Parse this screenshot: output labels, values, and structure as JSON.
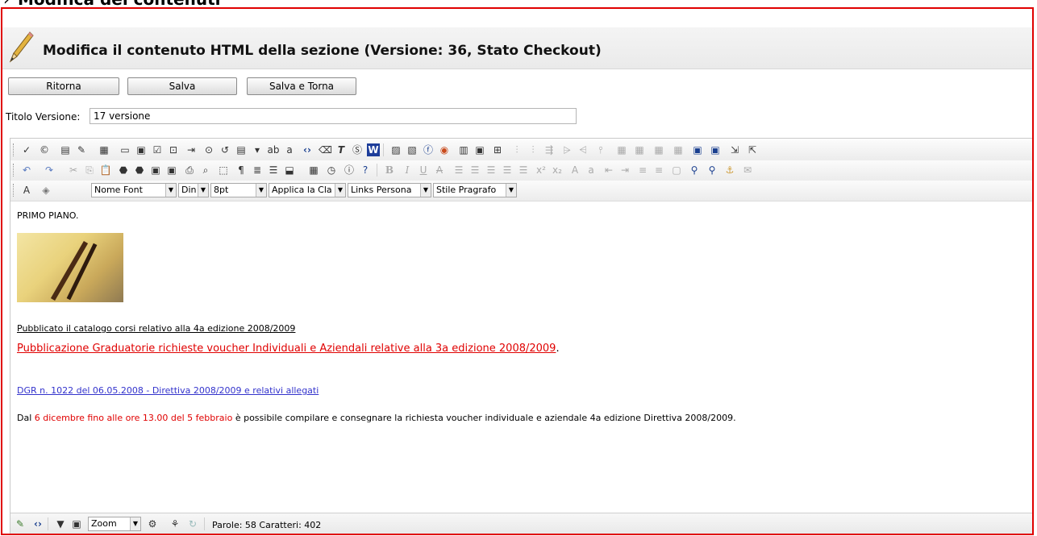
{
  "page": {
    "heading": "Modifica dei contenuti",
    "heading_marker": "›",
    "title": "Modifica il contenuto HTML della sezione (Versione: 36, Stato Checkout)"
  },
  "actions": {
    "back": "Ritorna",
    "save": "Salva",
    "save_return": "Salva e Torna"
  },
  "version": {
    "label": "Titolo Versione:",
    "value": "17 versione"
  },
  "toolbar": {
    "font_name": "Nome Font",
    "font_size_unit": "Din",
    "font_size": "8pt",
    "css_class": "Applica la Cla",
    "links": "Links Persona",
    "paragraph_style": "Stile Pragrafo"
  },
  "content": {
    "line1": "PRIMO PIANO.",
    "link1": "Pubblicato il catalogo corsi relativo alla 4a edizione 2008/2009",
    "link2": "Pubblicazione Graduatorie richieste voucher Individuali e Aziendali relative alla 3a edizione 2008/2009",
    "link2_end": ".",
    "link3": "DGR n. 1022 del 06.05.2008 - Direttiva 2008/2009 e relativi allegati",
    "line_start": "Dal ",
    "line_red": "6 dicembre fino alle ore 13.00 del 5 febbraio",
    "line_end": " è possibile compilare e consegnare la richiesta voucher individuale e aziendale 4a edizione Direttiva 2008/2009."
  },
  "status": {
    "zoom": "Zoom",
    "counts": "Parole: 58 Caratteri: 402"
  },
  "colors": {
    "frame_border": "#e00000",
    "red_link": "#e00000",
    "blue_link": "#3333cc"
  }
}
